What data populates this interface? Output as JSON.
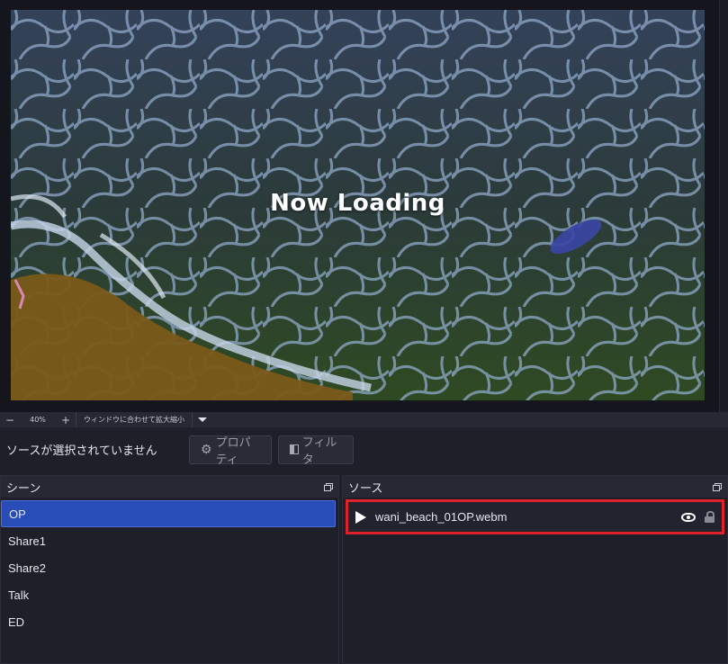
{
  "preview": {
    "title": "Now Loading"
  },
  "zoom_bar": {
    "minus": "−",
    "value": "40%",
    "plus": "+",
    "fit_label": "ウィンドウに合わせて拡大縮小"
  },
  "context_bar": {
    "no_source": "ソースが選択されていません",
    "properties_label": "プロパティ",
    "filters_label": "フィルタ",
    "properties_icon": "gear-icon",
    "filters_icon": "filter-icon"
  },
  "scenes": {
    "title": "シーン",
    "items": [
      {
        "label": "OP",
        "selected": true
      },
      {
        "label": "Share1",
        "selected": false
      },
      {
        "label": "Share2",
        "selected": false
      },
      {
        "label": "Talk",
        "selected": false
      },
      {
        "label": "ED",
        "selected": false
      }
    ]
  },
  "sources": {
    "title": "ソース",
    "items": [
      {
        "label": "wani_beach_01OP.webm",
        "visible": true,
        "locked": true
      }
    ]
  },
  "colors": {
    "accent_selected": "#284cb8",
    "highlight_border": "#e0202a",
    "background": "#1e1f29"
  }
}
